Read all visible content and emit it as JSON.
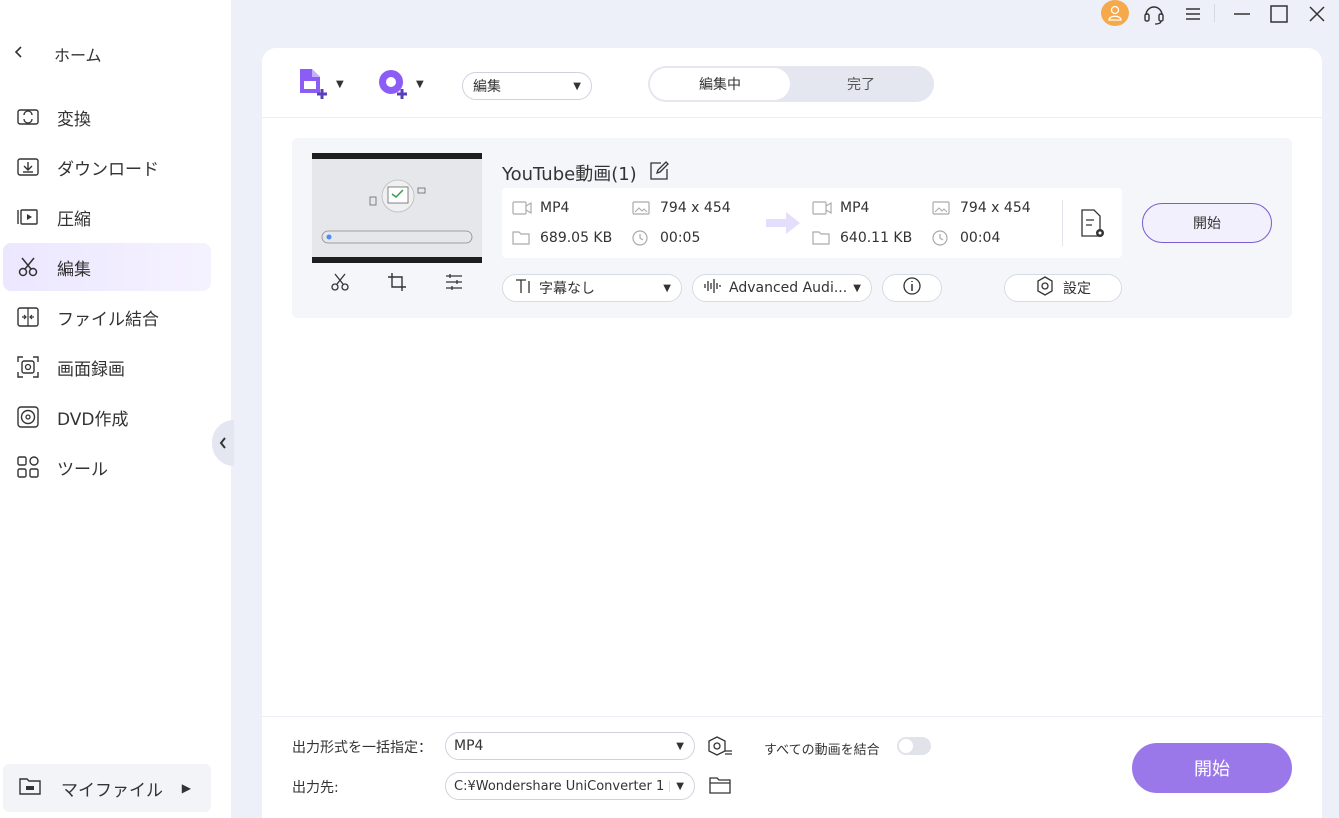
{
  "sidebar": {
    "home_label": "ホーム",
    "items": [
      {
        "label": "変換",
        "icon": "convert-icon"
      },
      {
        "label": "ダウンロード",
        "icon": "download-icon"
      },
      {
        "label": "圧縮",
        "icon": "compress-icon"
      },
      {
        "label": "編集",
        "icon": "scissors-icon",
        "active": true
      },
      {
        "label": "ファイル結合",
        "icon": "merge-icon"
      },
      {
        "label": "画面録画",
        "icon": "screen-record-icon"
      },
      {
        "label": "DVD作成",
        "icon": "dvd-icon"
      },
      {
        "label": "ツール",
        "icon": "tools-icon"
      }
    ],
    "myfile_label": "マイファイル"
  },
  "toolbar": {
    "edit_select_value": "編集",
    "tab_editing": "編集中",
    "tab_done": "完了"
  },
  "file": {
    "title": "YouTube動画(1)",
    "src_format": "MP4",
    "src_resolution": "794 x 454",
    "src_size": "689.05 KB",
    "src_duration": "00:05",
    "dst_format": "MP4",
    "dst_resolution": "794 x 454",
    "dst_size": "640.11 KB",
    "dst_duration": "00:04",
    "start_label": "開始",
    "subtitle_select": "字幕なし",
    "audio_select": "Advanced Audi...",
    "settings_label": "設定"
  },
  "bottom": {
    "output_format_label": "出力形式を一括指定：",
    "output_format_value": "MP4",
    "merge_label": "すべての動画を結合",
    "merge_on": false,
    "output_path_label": "出力先:",
    "output_path_value": "C:¥Wondershare UniConverter 1",
    "start_label": "開始"
  },
  "colors": {
    "accent": "#9a78e9",
    "avatar": "#f5a94a",
    "background": "#eef0f9"
  }
}
